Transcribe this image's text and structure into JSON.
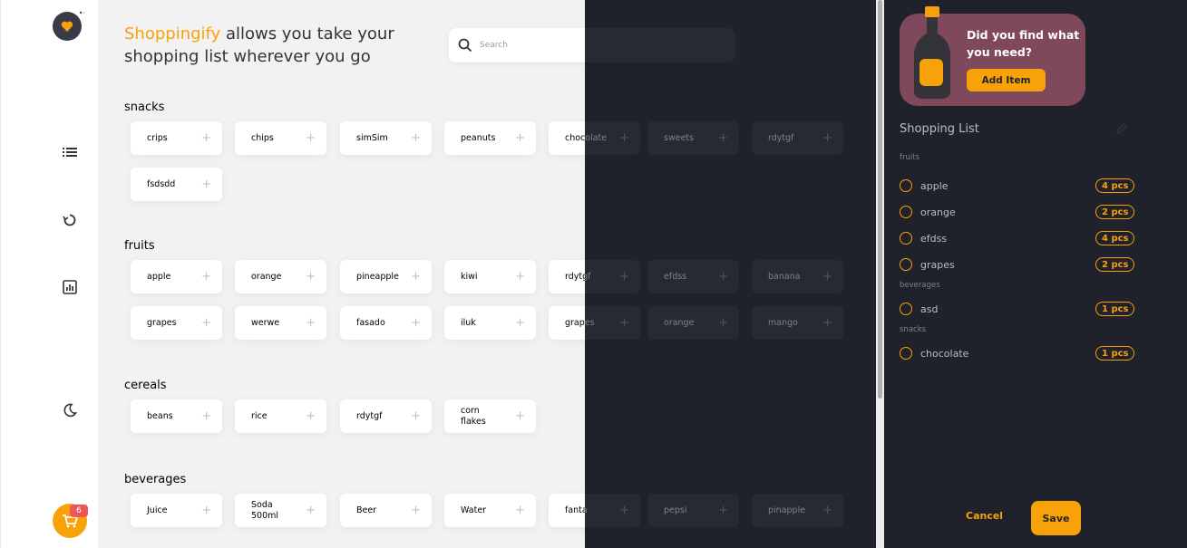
{
  "colors": {
    "accent": "#f9a109",
    "promo": "#80485b",
    "badge": "#eb5757",
    "panel": "#1f222a"
  },
  "nav": {
    "logo_icon": "heart-logo-icon",
    "items": [
      {
        "icon": "list-icon"
      },
      {
        "icon": "history-icon"
      },
      {
        "icon": "statistics-icon"
      },
      {
        "icon": "moon-icon"
      }
    ],
    "cart_count": "6"
  },
  "header": {
    "brand": "Shoppingify",
    "headline_rest": " allows you take your shopping list wherever you go",
    "search_placeholder": "Search"
  },
  "categories": [
    {
      "name": "snacks",
      "items": [
        "crips",
        "chips",
        "simSim",
        "peanuts",
        "chocolate",
        "sweets",
        "rdytgf",
        "fsdsdd"
      ]
    },
    {
      "name": "fruits",
      "items": [
        "apple",
        "orange",
        "pineapple",
        "kiwi",
        "rdytgf",
        "efdss",
        "banana",
        "grapes",
        "werwe",
        "fasado",
        "iluk",
        "grapes",
        "orange",
        "mango"
      ]
    },
    {
      "name": "cereals",
      "items": [
        "beans",
        "rice",
        "rdytgf",
        "corn flakes"
      ]
    },
    {
      "name": "beverages",
      "items": [
        "Juice",
        "Soda 500ml",
        "Beer",
        "Water",
        "fanta",
        "pepsi",
        "pinapple"
      ]
    }
  ],
  "sidebar": {
    "promo_text": "Did you find what you need?",
    "add_item_label": "Add Item",
    "list_title": "Shopping List",
    "groups": [
      {
        "label": "fruits",
        "items": [
          {
            "name": "apple",
            "qty": "4 pcs"
          },
          {
            "name": "orange",
            "qty": "2 pcs"
          },
          {
            "name": "efdss",
            "qty": "4 pcs"
          },
          {
            "name": "grapes",
            "qty": "2 pcs"
          }
        ]
      },
      {
        "label": "beverages",
        "items": [
          {
            "name": "asd",
            "qty": "1 pcs"
          }
        ]
      },
      {
        "label": "snacks",
        "items": [
          {
            "name": "chocolate",
            "qty": "1 pcs"
          }
        ]
      }
    ],
    "cancel_label": "Cancel",
    "save_label": "Save"
  }
}
